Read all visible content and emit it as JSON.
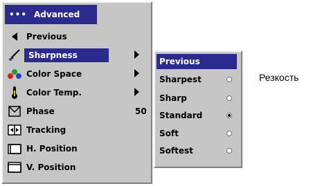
{
  "menu": {
    "title": "Advanced",
    "title_dots": "•••",
    "items": [
      {
        "icon": "triangle-left-icon",
        "label": "Previous"
      },
      {
        "icon": "sharpness-brush-icon",
        "label": "Sharpness",
        "selected": true,
        "submenu": true
      },
      {
        "icon": "color-space-icon",
        "label": "Color Space",
        "submenu": true
      },
      {
        "icon": "thermometer-icon",
        "label": "Color Temp.",
        "submenu": true
      },
      {
        "icon": "phase-icon",
        "label": "Phase",
        "value": "50"
      },
      {
        "icon": "tracking-icon",
        "label": "Tracking"
      },
      {
        "icon": "h-position-icon",
        "label": "H. Position"
      },
      {
        "icon": "v-position-icon",
        "label": "V. Position"
      }
    ]
  },
  "submenu": {
    "title": "Previous",
    "options": [
      {
        "label": "Sharpest",
        "selected": false
      },
      {
        "label": "Sharp",
        "selected": false
      },
      {
        "label": "Standard",
        "selected": true
      },
      {
        "label": "Soft",
        "selected": false
      },
      {
        "label": "Softest",
        "selected": false
      }
    ]
  },
  "caption": "Резкость",
  "colors": {
    "highlight": "#2b2b8e",
    "panel": "#c6c6c6"
  }
}
